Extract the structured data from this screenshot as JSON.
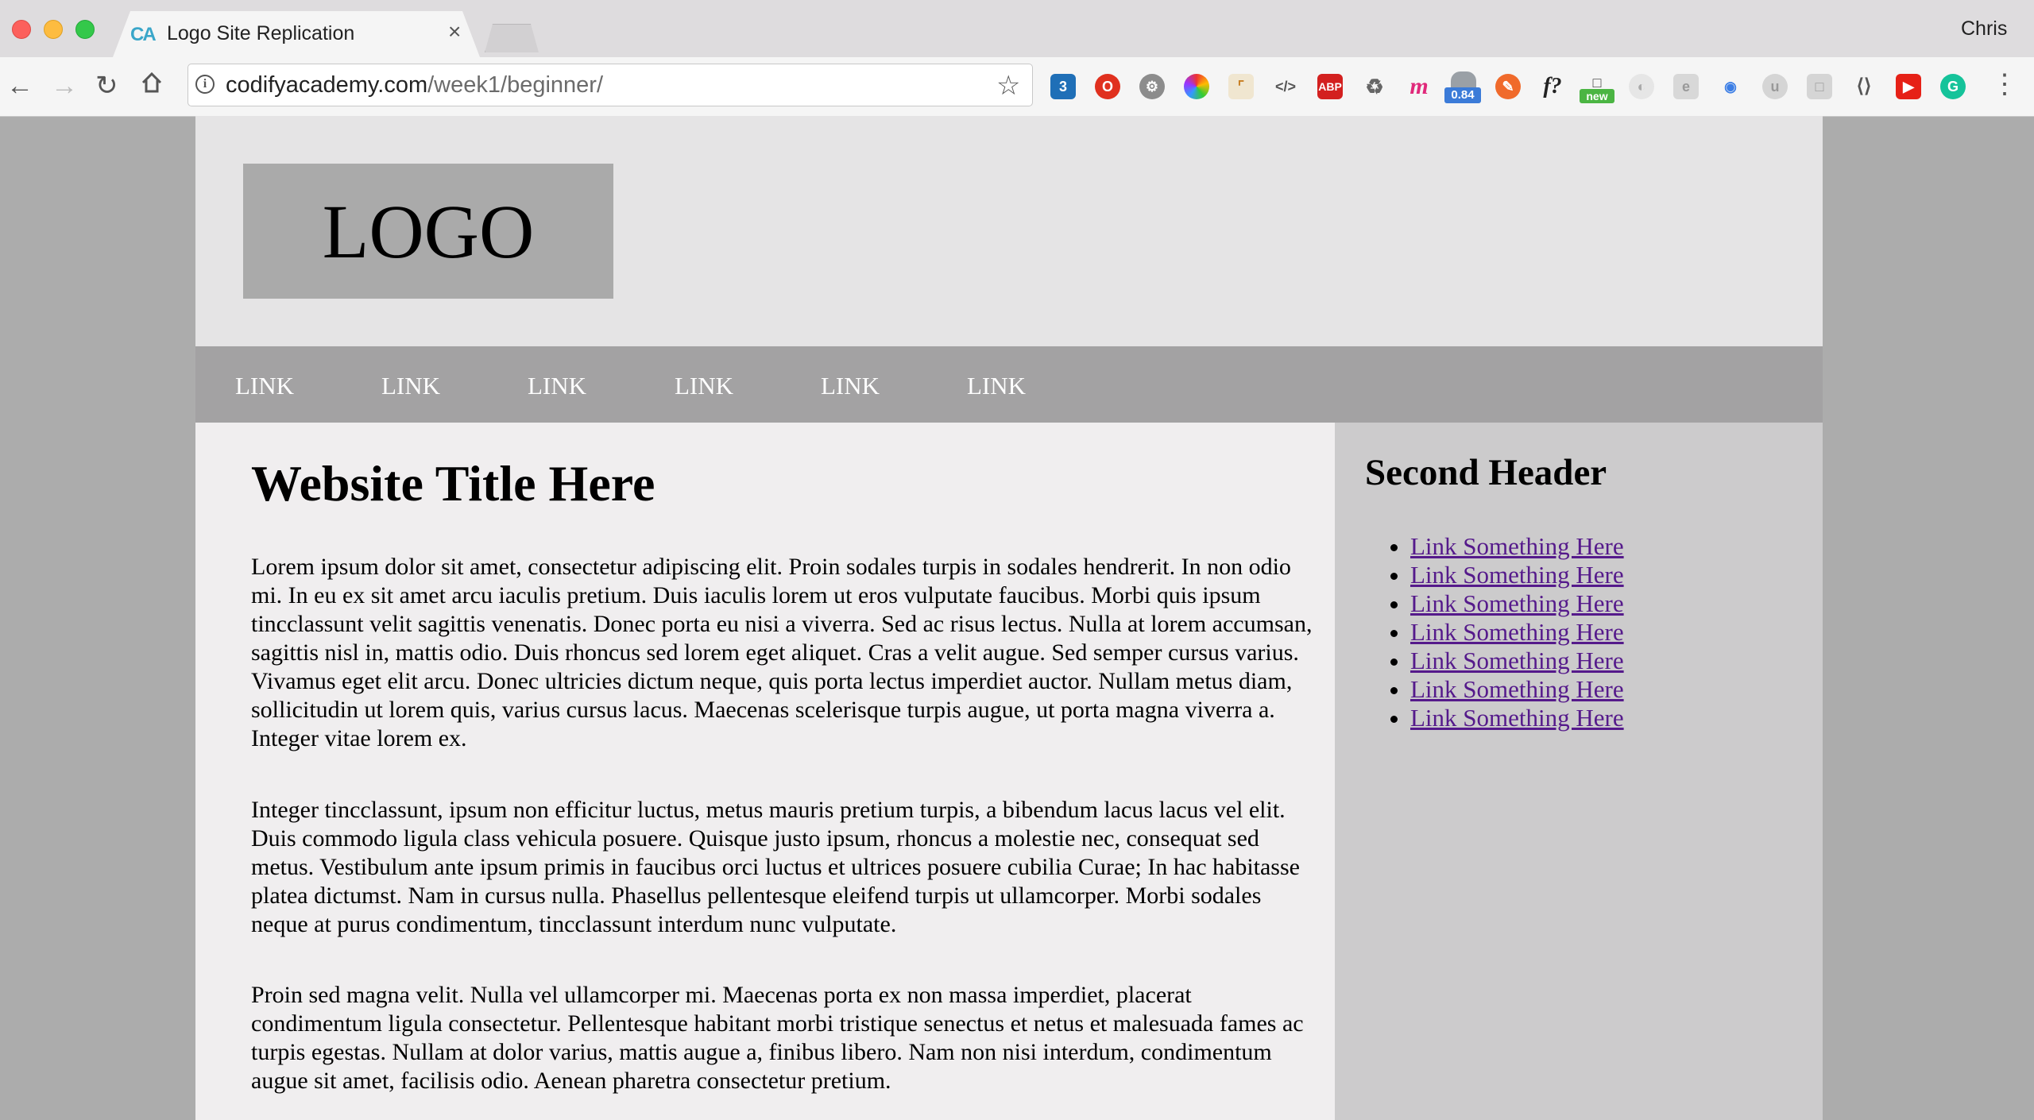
{
  "browser": {
    "tab_title": "Logo Site Replication",
    "tab_favicon": "CA",
    "tab_close": "×",
    "user_name": "Chris",
    "url_domain": "codifyacademy.com",
    "url_path": "/week1/beginner/",
    "extension_badges": [
      "0.84",
      "new"
    ],
    "icons": [
      "back-arrow-icon",
      "forward-arrow-icon",
      "reload-icon",
      "home-icon",
      "info-icon",
      "star-icon",
      "more-menu-icon"
    ]
  },
  "site": {
    "logo": "LOGO",
    "nav_links": [
      "LINK",
      "LINK",
      "LINK",
      "LINK",
      "LINK",
      "LINK"
    ],
    "title": "Website Title Here",
    "paragraphs": [
      "Lorem ipsum dolor sit amet, consectetur adipiscing elit. Proin sodales turpis in sodales hendrerit. In non odio mi. In eu ex sit amet arcu iaculis pretium. Duis iaculis lorem ut eros vulputate faucibus. Morbi quis ipsum tincclassunt velit sagittis venenatis. Donec porta eu nisi a viverra. Sed ac risus lectus. Nulla at lorem accumsan, sagittis nisl in, mattis odio. Duis rhoncus sed lorem eget aliquet. Cras a velit augue. Sed semper cursus varius. Vivamus eget elit arcu. Donec ultricies dictum neque, quis porta lectus imperdiet auctor. Nullam metus diam, sollicitudin ut lorem quis, varius cursus lacus. Maecenas scelerisque turpis augue, ut porta magna viverra a. Integer vitae lorem ex.",
      "Integer tincclassunt, ipsum non efficitur luctus, metus mauris pretium turpis, a bibendum lacus lacus vel elit. Duis commodo ligula class vehicula posuere. Quisque justo ipsum, rhoncus a molestie nec, consequat sed metus. Vestibulum ante ipsum primis in faucibus orci luctus et ultrices posuere cubilia Curae; In hac habitasse platea dictumst. Nam in cursus nulla. Phasellus pellentesque eleifend turpis ut ullamcorper. Morbi sodales neque at purus condimentum, tincclassunt interdum nunc vulputate.",
      "Proin sed magna velit. Nulla vel ullamcorper mi. Maecenas porta ex non massa imperdiet, placerat condimentum ligula consectetur. Pellentesque habitant morbi tristique senectus et netus et malesuada fames ac turpis egestas. Nullam at dolor varius, mattis augue a, finibus libero. Nam non nisi interdum, condimentum augue sit amet, facilisis odio. Aenean pharetra consectetur pretium."
    ],
    "sidebar_title": "Second Header",
    "sidebar_links": [
      "Link Something Here",
      "Link Something Here",
      "Link Something Here",
      "Link Something Here",
      "Link Something Here",
      "Link Something Here",
      "Link Something Here"
    ]
  },
  "colors": {
    "page_bg": "#acacac",
    "header_bg": "#e5e4e5",
    "nav_bg": "#a3a2a3",
    "main_bg": "#f0eeef",
    "sidebar_bg": "#cccbcc",
    "visited_link": "#551a8b"
  }
}
